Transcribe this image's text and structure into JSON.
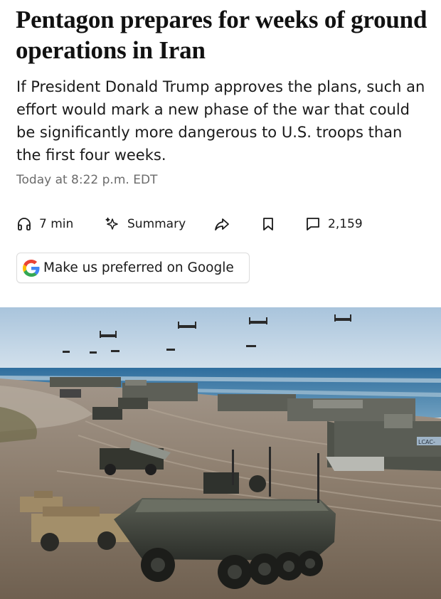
{
  "article": {
    "headline": "Pentagon prepares for weeks of ground operations in Iran",
    "dek": "If President Donald Trump approves the plans, such an effort would mark a new phase of the war that could be significantly more dangerous to U.S. troops than the first four weeks.",
    "timestamp": "Today at 8:22 p.m. EDT"
  },
  "actions": {
    "listen": {
      "icon": "headphones-icon",
      "label": "7 min"
    },
    "summary": {
      "icon": "sparkle-icon",
      "label": "Summary"
    },
    "share": {
      "icon": "share-arrow-icon"
    },
    "save": {
      "icon": "bookmark-icon"
    },
    "comments": {
      "icon": "comment-icon",
      "label": "2,159"
    }
  },
  "google_preferred": {
    "icon": "google-g-icon",
    "label": "Make us preferred on Google"
  },
  "photo": {
    "overlay_text": "LCAC-"
  },
  "colors": {
    "text": "#111111",
    "muted": "#6b6b6b",
    "sky": "#b7cfe3",
    "sea": "#3f7fae",
    "sand": "#8a7a68",
    "google_blue": "#4285F4",
    "google_red": "#EA4335",
    "google_yellow": "#FBBC05",
    "google_green": "#34A853"
  }
}
